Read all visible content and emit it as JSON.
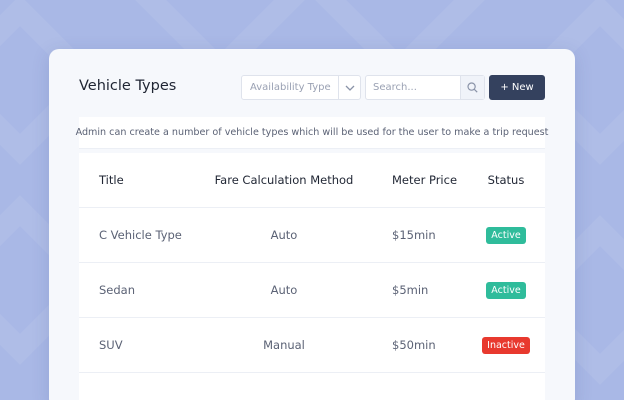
{
  "page": {
    "title": "Vehicle Types",
    "description": "Admin can create a number of vehicle types which will be used for the user to make a trip request"
  },
  "toolbar": {
    "availability_filter": "Availability Type",
    "search_placeholder": "Search...",
    "new_button": "+ New"
  },
  "table": {
    "columns": [
      "Title",
      "Fare Calculation Method",
      "Meter Price",
      "Status"
    ],
    "rows": [
      {
        "title": "C Vehicle Type",
        "method": "Auto",
        "price": "$15min",
        "status": "Active"
      },
      {
        "title": "Sedan",
        "method": "Auto",
        "price": "$5min",
        "status": "Active"
      },
      {
        "title": "SUV",
        "method": "Manual",
        "price": "$50min",
        "status": "Inactive"
      }
    ]
  },
  "colors": {
    "background": "#a9b8e6",
    "primary_button": "#34415e",
    "active": "#2fbc9b",
    "inactive": "#e8392e"
  },
  "icons": {
    "filter": "chevron-down-icon",
    "search": "search-icon"
  }
}
